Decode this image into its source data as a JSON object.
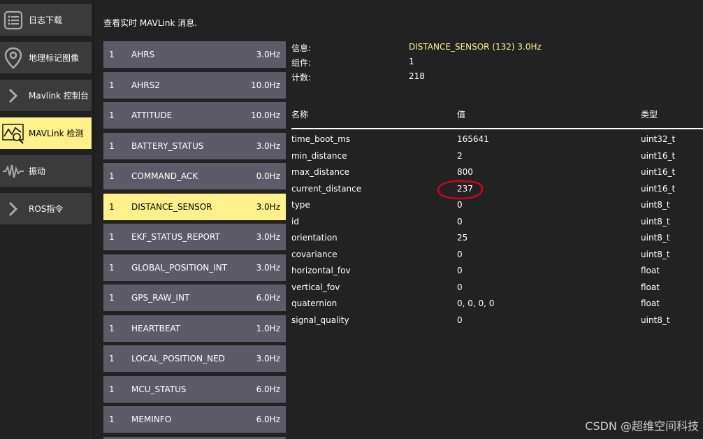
{
  "nav": {
    "items": [
      {
        "label": "日志下载",
        "icon": "list-icon",
        "active": false
      },
      {
        "label": "地理标记图像",
        "icon": "map-pin-icon",
        "active": false
      },
      {
        "label": "Mavlink 控制台",
        "icon": "chevron-right-icon",
        "active": false
      },
      {
        "label": "MAVLink 检测",
        "icon": "chart-inspect-icon",
        "active": true
      },
      {
        "label": "振动",
        "icon": "waveform-icon",
        "active": false
      },
      {
        "label": "ROS指令",
        "icon": "chevron-right-icon",
        "active": false
      }
    ]
  },
  "header": {
    "hint": "查看实时 MAVLink 消息."
  },
  "messages": [
    {
      "component": "1",
      "name": "AHRS",
      "rate": "3.0Hz",
      "active": false
    },
    {
      "component": "1",
      "name": "AHRS2",
      "rate": "10.0Hz",
      "active": false
    },
    {
      "component": "1",
      "name": "ATTITUDE",
      "rate": "10.0Hz",
      "active": false
    },
    {
      "component": "1",
      "name": "BATTERY_STATUS",
      "rate": "3.0Hz",
      "active": false
    },
    {
      "component": "1",
      "name": "COMMAND_ACK",
      "rate": "0.0Hz",
      "active": false
    },
    {
      "component": "1",
      "name": "DISTANCE_SENSOR",
      "rate": "3.0Hz",
      "active": true
    },
    {
      "component": "1",
      "name": "EKF_STATUS_REPORT",
      "rate": "3.0Hz",
      "active": false
    },
    {
      "component": "1",
      "name": "GLOBAL_POSITION_INT",
      "rate": "3.0Hz",
      "active": false
    },
    {
      "component": "1",
      "name": "GPS_RAW_INT",
      "rate": "6.0Hz",
      "active": false
    },
    {
      "component": "1",
      "name": "HEARTBEAT",
      "rate": "1.0Hz",
      "active": false
    },
    {
      "component": "1",
      "name": "LOCAL_POSITION_NED",
      "rate": "3.0Hz",
      "active": false
    },
    {
      "component": "1",
      "name": "MCU_STATUS",
      "rate": "6.0Hz",
      "active": false
    },
    {
      "component": "1",
      "name": "MEMINFO",
      "rate": "6.0Hz",
      "active": false
    }
  ],
  "detail": {
    "info": [
      {
        "key": "信息:",
        "value": "DISTANCE_SENSOR (132) 3.0Hz",
        "highlight": true
      },
      {
        "key": "组件:",
        "value": "1",
        "highlight": false
      },
      {
        "key": "计数:",
        "value": "218",
        "highlight": false
      }
    ],
    "columns": {
      "name": "名称",
      "value": "值",
      "type": "类型"
    },
    "fields": [
      {
        "name": "time_boot_ms",
        "value": "165641",
        "type": "uint32_t"
      },
      {
        "name": "min_distance",
        "value": "2",
        "type": "uint16_t"
      },
      {
        "name": "max_distance",
        "value": "800",
        "type": "uint16_t"
      },
      {
        "name": "current_distance",
        "value": "237",
        "type": "uint16_t"
      },
      {
        "name": "type",
        "value": "0",
        "type": "uint8_t"
      },
      {
        "name": "id",
        "value": "0",
        "type": "uint8_t"
      },
      {
        "name": "orientation",
        "value": "25",
        "type": "uint8_t"
      },
      {
        "name": "covariance",
        "value": "0",
        "type": "uint8_t"
      },
      {
        "name": "horizontal_fov",
        "value": "0",
        "type": "float"
      },
      {
        "name": "vertical_fov",
        "value": "0",
        "type": "float"
      },
      {
        "name": "quaternion",
        "value": "0, 0, 0, 0",
        "type": "float"
      },
      {
        "name": "signal_quality",
        "value": "0",
        "type": "uint8_t"
      }
    ]
  },
  "watermark": "CSDN @超维空间科技",
  "colors": {
    "background": "#222222",
    "nav_item": "#3b3b3b",
    "active": "#fef08a",
    "message_row": "#5d5b68",
    "annotation": "#d0021b"
  }
}
